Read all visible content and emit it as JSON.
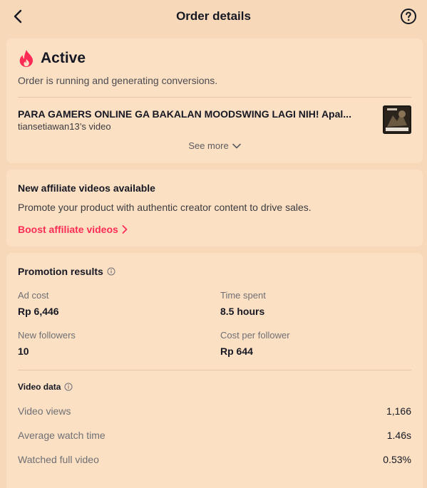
{
  "header": {
    "title": "Order details"
  },
  "status": {
    "label": "Active",
    "description": "Order is running and generating conversions.",
    "video_title": "PARA GAMERS ONLINE GA BAKALAN MOODSWING LAGI NIH! Apal...",
    "video_owner": "tiansetiawan13’s video",
    "see_more": "See more"
  },
  "affiliate": {
    "title": "New affiliate videos available",
    "description": "Promote your product with authentic creator content to drive sales.",
    "link": "Boost affiliate videos"
  },
  "results": {
    "title": "Promotion results",
    "metrics": [
      {
        "label": "Ad cost",
        "value": "Rp 6,446"
      },
      {
        "label": "Time spent",
        "value": "8.5 hours"
      },
      {
        "label": "New followers",
        "value": "10"
      },
      {
        "label": "Cost per follower",
        "value": "Rp 644"
      }
    ]
  },
  "video_data": {
    "title": "Video data",
    "rows": [
      {
        "label": "Video views",
        "value": "1,166"
      },
      {
        "label": "Average watch time",
        "value": "1.46s"
      },
      {
        "label": "Watched full video",
        "value": "0.53%"
      }
    ]
  },
  "colors": {
    "background": "#f7d9ba",
    "card": "#fbe0c4",
    "accent": "#fe2c55"
  },
  "icons": [
    "back-arrow-icon",
    "help-icon",
    "flame-icon",
    "chevron-down-icon",
    "chevron-right-icon",
    "info-icon"
  ]
}
